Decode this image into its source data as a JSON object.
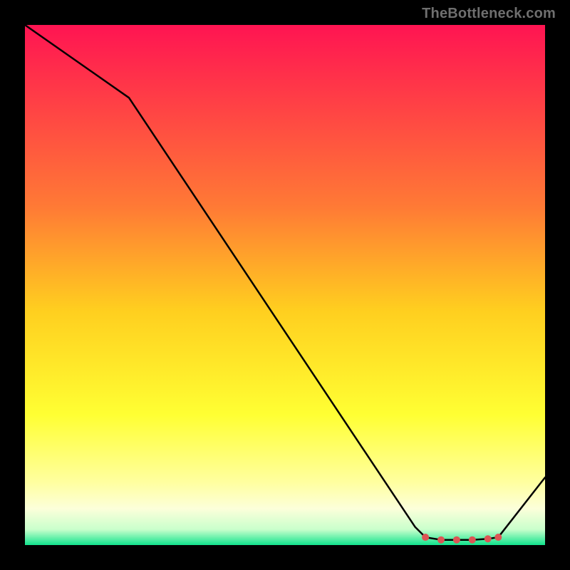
{
  "attribution": "TheBottleneck.com",
  "chart_data": {
    "type": "line",
    "x": [
      0,
      20,
      75,
      77,
      80,
      83,
      86,
      89,
      91,
      100
    ],
    "values": [
      100,
      86,
      3.5,
      1.5,
      1,
      1,
      1,
      1.2,
      1.5,
      13
    ],
    "title": "",
    "xlabel": "",
    "ylabel": "",
    "xlim": [
      0,
      100
    ],
    "ylim": [
      0,
      100
    ],
    "markers": [
      {
        "x": 77,
        "y": 1.5
      },
      {
        "x": 80,
        "y": 1.0
      },
      {
        "x": 83,
        "y": 1.0
      },
      {
        "x": 86,
        "y": 1.0
      },
      {
        "x": 89,
        "y": 1.2
      },
      {
        "x": 91,
        "y": 1.5
      }
    ],
    "marker_color": "#dd5555",
    "line_color": "#000000",
    "gradient_stops": [
      {
        "offset": 0.0,
        "color": "#ff1452"
      },
      {
        "offset": 0.35,
        "color": "#ff7a35"
      },
      {
        "offset": 0.55,
        "color": "#ffcf1f"
      },
      {
        "offset": 0.75,
        "color": "#ffff33"
      },
      {
        "offset": 0.88,
        "color": "#ffffa0"
      },
      {
        "offset": 0.93,
        "color": "#fcffda"
      },
      {
        "offset": 0.97,
        "color": "#c9ffcc"
      },
      {
        "offset": 1.0,
        "color": "#11e38d"
      }
    ]
  }
}
